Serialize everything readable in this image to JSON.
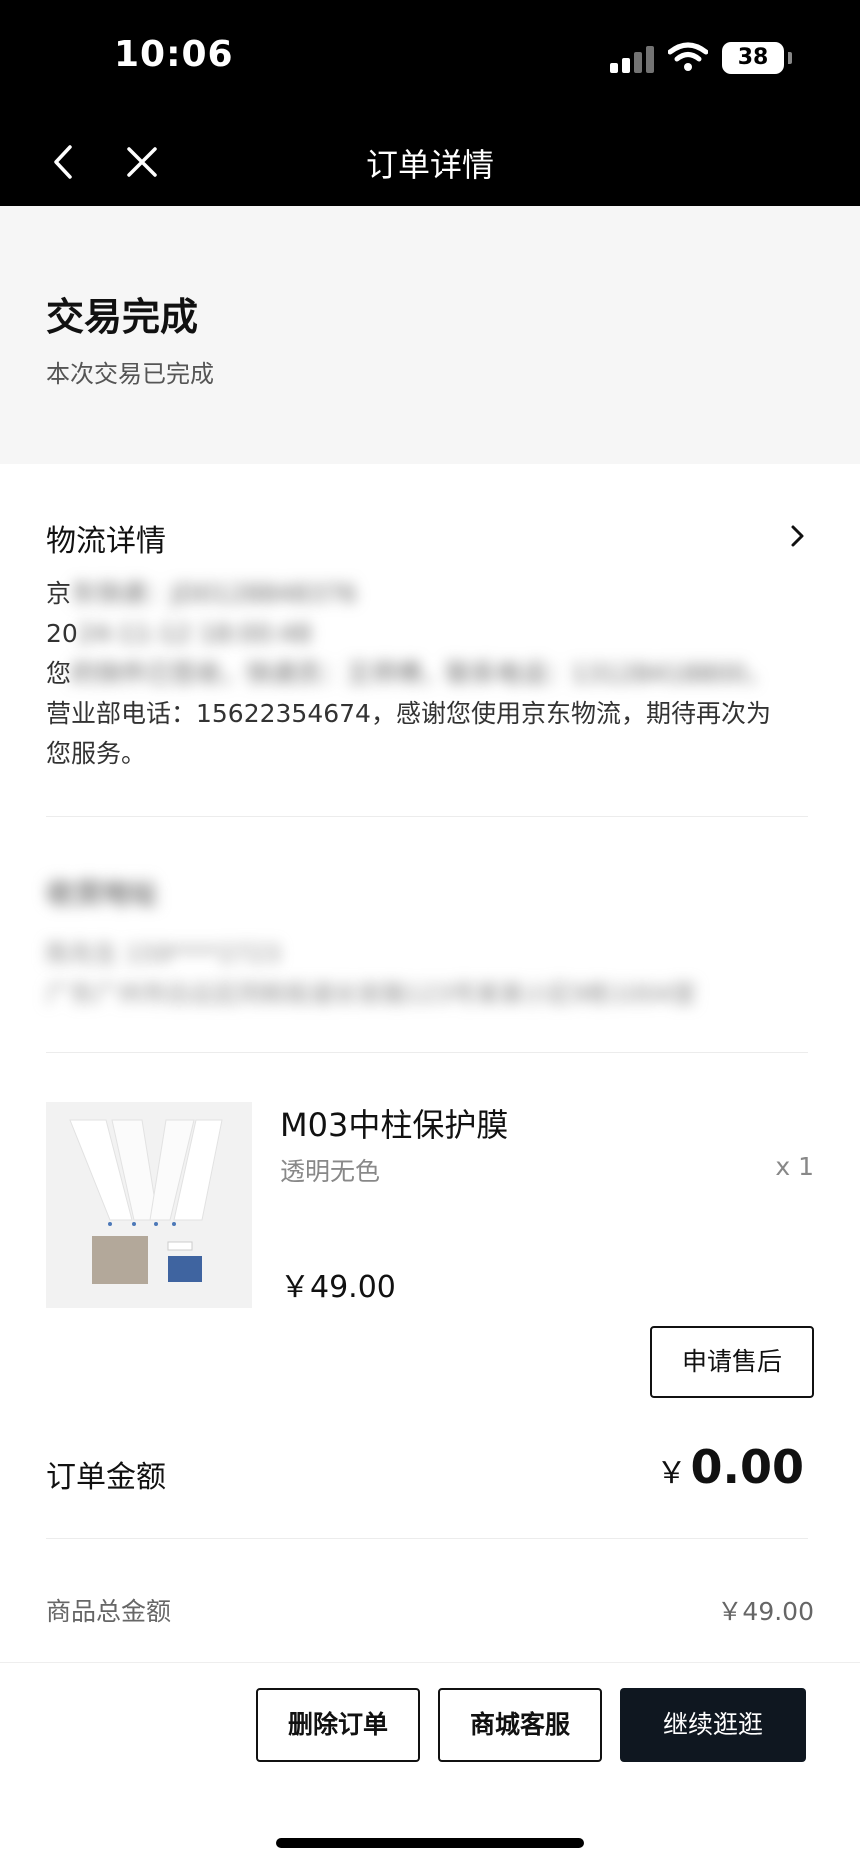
{
  "status_bar": {
    "time": "10:06",
    "battery": "38"
  },
  "nav": {
    "title": "订单详情"
  },
  "order_status": {
    "title": "交易完成",
    "subtitle": "本次交易已完成"
  },
  "logistics": {
    "title": "物流详情",
    "line1_visible": "京",
    "line1_blurred": "东快递：JD0128848376",
    "line2_visible": "20",
    "line2_blurred": "24-11-12 18:00:48",
    "line3_visible": "您",
    "line3_blurred": "的快件已签收，快递员：王师傅，联系电话：13128418800，",
    "line4": "营业部电话：15622354674，感谢您使用京东物流，期待再次为",
    "line5": "您服务。"
  },
  "address": {
    "title": "收货地址",
    "line1": "陈先生 159****2723",
    "line2": "广东广州市白云区同和街道长安路123号某某小区9栋1004室"
  },
  "product": {
    "name": "M03中柱保护膜",
    "spec": "透明无色",
    "qty": "x 1",
    "price": "￥49.00",
    "after_sale_label": "申请售后"
  },
  "summary": {
    "order_amount_label": "订单金额",
    "order_amount_currency": "￥",
    "order_amount_value": "0.00",
    "goods_total_label": "商品总金额",
    "goods_total_value": "￥49.00"
  },
  "actions": {
    "delete_label": "删除订单",
    "service_label": "商城客服",
    "continue_label": "继续逛逛"
  },
  "colors": {
    "topbar": "#000000",
    "status_bg": "#f6f6f6",
    "primary_button": "#0f1720"
  }
}
